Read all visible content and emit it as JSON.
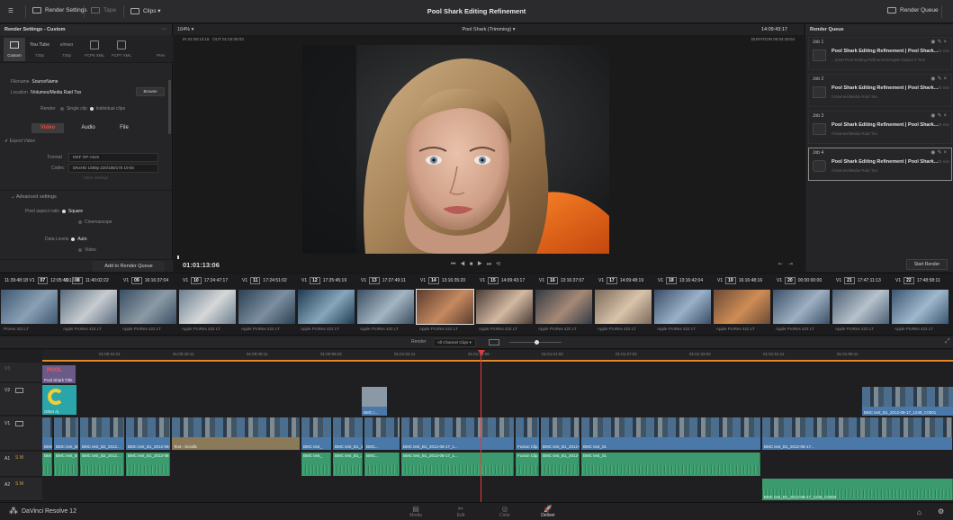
{
  "topbar": {
    "render_settings": "Render Settings",
    "tape": "Tape",
    "clips": "Clips",
    "title": "Pool Shark Editing Refinement",
    "render_queue": "Render Queue"
  },
  "render_settings": {
    "header": "Render Settings - Custom",
    "presets": [
      {
        "top": "Custom",
        "bottom": "Custom"
      },
      {
        "top": "You Tube",
        "bottom": "720p"
      },
      {
        "top": "vimeo",
        "bottom": "720p"
      },
      {
        "top": "",
        "bottom": "FCP6 XML"
      },
      {
        "top": "",
        "bottom": "FCP7 XML"
      },
      {
        "top": "",
        "bottom": "Pren"
      }
    ],
    "filename_label": "Filename",
    "filename_value": "SourceName",
    "location_label": "Location",
    "location_value": "/Volumes/Media Raid Too",
    "browse": "Browse",
    "render_label": "Render",
    "render_single": "Single clip",
    "render_individual": "Individual clips",
    "tabs": [
      "Video",
      "Audio",
      "File"
    ],
    "export_video": "Export Video",
    "format_label": "Format",
    "format_value": "MXF OP-Atom",
    "codec_label": "Codec",
    "codec_value": "DNxHD 1080p 220/185/175 10-bit",
    "more_settings": "Video settings",
    "advanced": "Advanced settings",
    "pixel_aspect_label": "Pixel aspect ratio",
    "pixel_square": "Square",
    "pixel_cinemascope": "Cinemascope",
    "data_levels_label": "Data Levels",
    "data_auto": "Auto",
    "data_video": "Video",
    "add_to_queue": "Add to Render Queue"
  },
  "viewer": {
    "zoom": "104%",
    "in": "IN  01:00:13:16",
    "out": "OUT  01:02:05:03",
    "timeline_name": "Pool Shark (Trimming)",
    "timecode_top": "14:09:43:17",
    "duration": "DURATION  00:04:49:04",
    "timecode": "01:01:13:06"
  },
  "render_queue": {
    "header": "Render Queue",
    "jobs": [
      {
        "num": "Job 1",
        "title": "Pool Shark Editing Refinement | Pool Shark...",
        "path": "...ment Pool Editing Refinement/Apple Output 3 Test",
        "time": "25 min"
      },
      {
        "num": "Job 2",
        "title": "Pool Shark Editing Refinement | Pool Shark...",
        "path": "/Volumes/Media Raid Too",
        "time": "25 min"
      },
      {
        "num": "Job 3",
        "title": "Pool Shark Editing Refinement | Pool Shark...",
        "path": "/Volumes/Media Raid Too",
        "time": "25 min"
      },
      {
        "num": "Job 4",
        "title": "Pool Shark Editing Refinement | Pool Shark...",
        "path": "/Volumes/Media Raid Too",
        "time": "25 min"
      }
    ],
    "start_render": "Start Render"
  },
  "clips": [
    {
      "tc": "11:39:48:18",
      "num": "07",
      "tc2": "12:05:46:15",
      "label": "Prores 422 LT"
    },
    {
      "tc": "",
      "num": "08",
      "tc2": "11:40:02:22",
      "label": "Apple ProRes 422 LT"
    },
    {
      "tc": "",
      "num": "09",
      "tc2": "16:16:37:04",
      "label": "Apple ProRes 422 LT"
    },
    {
      "tc": "",
      "num": "10",
      "tc2": "17:24:47:17",
      "label": "Apple ProRes 422 LT"
    },
    {
      "tc": "",
      "num": "11",
      "tc2": "17:24:51:02",
      "label": "Apple ProRes 422 LT"
    },
    {
      "tc": "",
      "num": "12",
      "tc2": "17:25:45:19",
      "label": "Apple ProRes 422 LT"
    },
    {
      "tc": "",
      "num": "13",
      "tc2": "17:27:49:11",
      "label": "Apple ProRes 422 LT"
    },
    {
      "tc": "",
      "num": "14",
      "tc2": "13:16:35:20",
      "label": "Apple ProRes 422 LT"
    },
    {
      "tc": "",
      "num": "15",
      "tc2": "14:09:43:17",
      "label": "Apple ProRes 422 LT"
    },
    {
      "tc": "",
      "num": "16",
      "tc2": "13:16:37:07",
      "label": "Apple ProRes 422 LT"
    },
    {
      "tc": "",
      "num": "17",
      "tc2": "14:09:48:19",
      "label": "Apple ProRes 422 LT"
    },
    {
      "tc": "",
      "num": "18",
      "tc2": "13:16:42:04",
      "label": "Apple ProRes 422 LT"
    },
    {
      "tc": "",
      "num": "19",
      "tc2": "16:16:48:16",
      "label": "Apple ProRes 422 LT"
    },
    {
      "tc": "",
      "num": "20",
      "tc2": "00:00:00:00",
      "label": "Apple ProRes 422 LT"
    },
    {
      "tc": "",
      "num": "21",
      "tc2": "17:47:11:13",
      "label": "Apple ProRes 422 LT"
    },
    {
      "tc": "",
      "num": "22",
      "tc2": "17:48:58:11",
      "label": "Apple ProRes 422 LT"
    }
  ],
  "timeline": {
    "render_label": "Render",
    "render_value": "All Channel Clips",
    "ruler": [
      "01:00:22:21",
      "01:00:40:11",
      "01:00:49:11",
      "01:00:59:22",
      "01:01:04:11",
      "01:01:13:06",
      "01:01:21:02",
      "01:01:27:04",
      "01:01:33:02",
      "01:01:51:11",
      "01:01:59:11"
    ],
    "tracks": {
      "v3": "V3",
      "v2": "V2",
      "v1": "V1",
      "a1": "A1",
      "a2": "A2"
    },
    "title_clip": "Pool Shark Title",
    "title_clip_2": "Other Aj",
    "v1_labels": [
      "BMC test_01",
      "BMC test_B1_2012-08-17...",
      "BMC test_B2_2012...",
      "BMC test_B1_2012-08-17_1159_C0000",
      "Text - Scrolls",
      "BMC test_",
      "BMC test_B1_2012-08-17...",
      "BMC...",
      "BMC test_B1_2012-08-17_1...",
      "Fusion Clip 1",
      "BMC test_B1_2012-08-17_1245_C0000"
    ],
    "v2_right_label": "BMC test_B1_2012-08-17_1248_C0001",
    "a2_right_label": "BMC test_B1_2012-08-17_1245_C0000"
  },
  "bottombar": {
    "app_name": "DaVinci Resolve 12",
    "pages": [
      "Media",
      "Edit",
      "Color",
      "Deliver"
    ]
  },
  "colors": {
    "playhead": "#e23c3c",
    "video_clip": "#4a78a8",
    "audio_clip": "#3c9b6e",
    "accent_orange": "#e3892c"
  }
}
